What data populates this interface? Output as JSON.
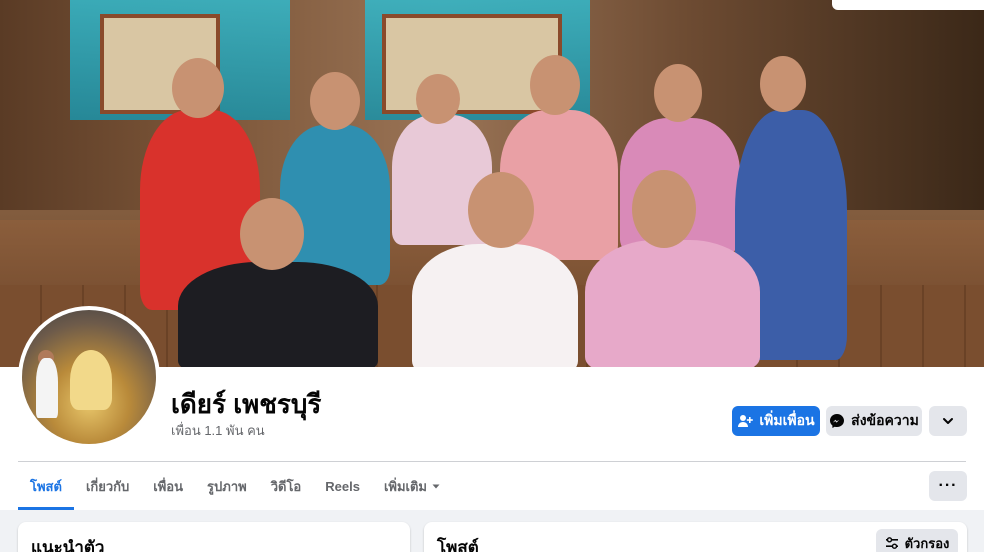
{
  "profile": {
    "name": "เดียร์ เพชรบุรี",
    "friends_count": "เพื่อน 1.1 พัน คน"
  },
  "actions": {
    "add_friend": "เพิ่มเพื่อน",
    "message": "ส่งข้อความ",
    "more_icon": "chevron-down-icon",
    "dots": "···"
  },
  "tabs": [
    {
      "label": "โพสต์",
      "active": true
    },
    {
      "label": "เกี่ยวกับ",
      "active": false
    },
    {
      "label": "เพื่อน",
      "active": false
    },
    {
      "label": "รูปภาพ",
      "active": false
    },
    {
      "label": "วิดีโอ",
      "active": false
    },
    {
      "label": "Reels",
      "active": false
    },
    {
      "label": "เพิ่มเติม",
      "active": false
    }
  ],
  "cards": {
    "intro_title": "แนะนำตัว",
    "posts_title": "โพสต์",
    "filter_label": "ตัวกรอง"
  },
  "colors": {
    "accent": "#1b74e4",
    "secondary_button": "#e4e6eb",
    "background": "#f0f2f5"
  }
}
